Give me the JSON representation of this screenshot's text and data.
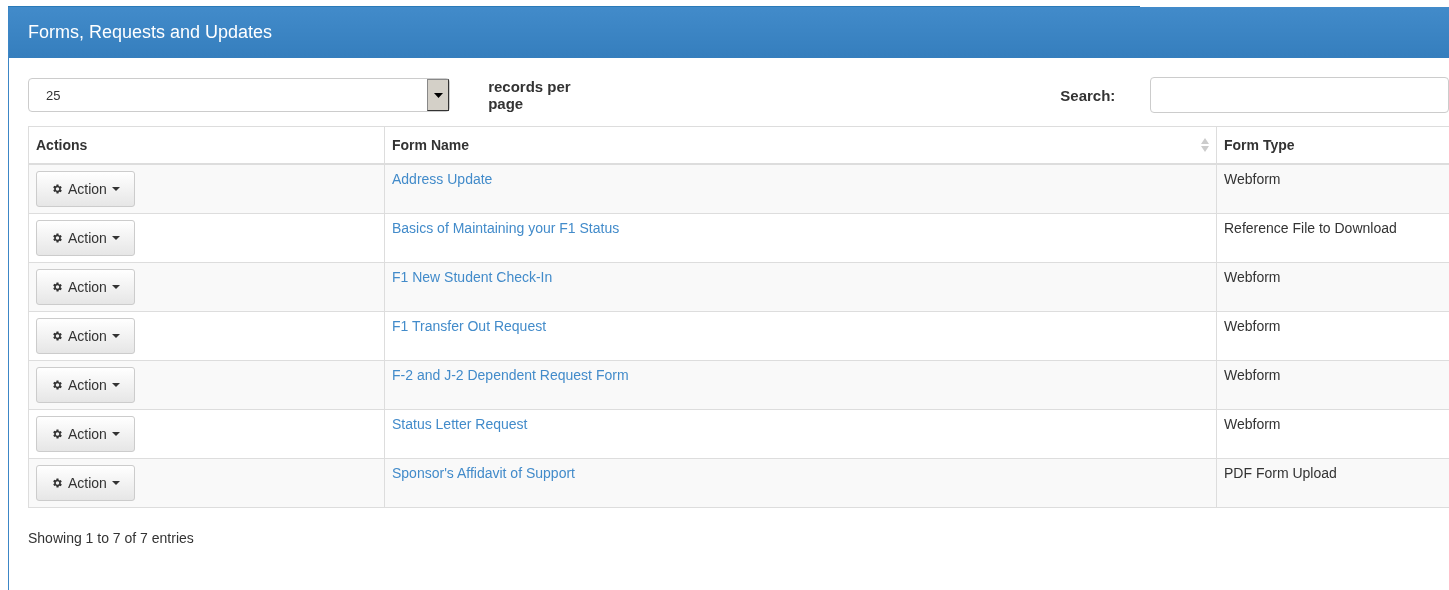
{
  "panel": {
    "title": "Forms, Requests and Updates"
  },
  "length_menu": {
    "value": "25",
    "label": "records per page"
  },
  "search": {
    "label": "Search:"
  },
  "table": {
    "columns": [
      "Actions",
      "Form Name",
      "Form Type"
    ],
    "rows": [
      {
        "action": "Action",
        "name": "Address Update",
        "type": "Webform"
      },
      {
        "action": "Action",
        "name": "Basics of Maintaining your F1 Status",
        "type": "Reference File to Download"
      },
      {
        "action": "Action",
        "name": "F1 New Student Check-In",
        "type": "Webform"
      },
      {
        "action": "Action",
        "name": "F1 Transfer Out Request",
        "type": "Webform"
      },
      {
        "action": "Action",
        "name": "F-2 and J-2 Dependent Request Form",
        "type": "Webform"
      },
      {
        "action": "Action",
        "name": "Status Letter Request",
        "type": "Webform"
      },
      {
        "action": "Action",
        "name": "Sponsor's Affidavit of Support",
        "type": "PDF Form Upload"
      }
    ]
  },
  "info": "Showing 1 to 7 of 7 entries"
}
